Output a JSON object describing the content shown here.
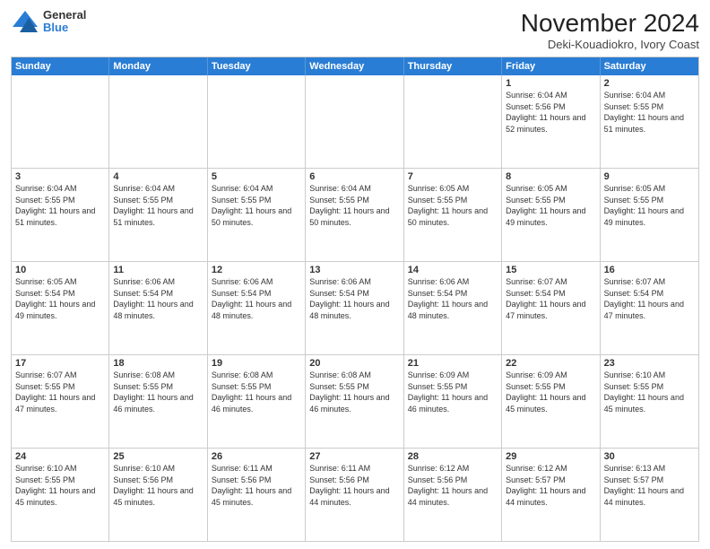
{
  "header": {
    "logo": {
      "line1": "General",
      "line2": "Blue"
    },
    "title": "November 2024",
    "location": "Deki-Kouadiokro, Ivory Coast"
  },
  "calendar": {
    "days_of_week": [
      "Sunday",
      "Monday",
      "Tuesday",
      "Wednesday",
      "Thursday",
      "Friday",
      "Saturday"
    ],
    "weeks": [
      [
        {
          "day": "",
          "info": "",
          "empty": true
        },
        {
          "day": "",
          "info": "",
          "empty": true
        },
        {
          "day": "",
          "info": "",
          "empty": true
        },
        {
          "day": "",
          "info": "",
          "empty": true
        },
        {
          "day": "",
          "info": "",
          "empty": true
        },
        {
          "day": "1",
          "info": "Sunrise: 6:04 AM\nSunset: 5:56 PM\nDaylight: 11 hours\nand 52 minutes."
        },
        {
          "day": "2",
          "info": "Sunrise: 6:04 AM\nSunset: 5:55 PM\nDaylight: 11 hours\nand 51 minutes."
        }
      ],
      [
        {
          "day": "3",
          "info": "Sunrise: 6:04 AM\nSunset: 5:55 PM\nDaylight: 11 hours\nand 51 minutes."
        },
        {
          "day": "4",
          "info": "Sunrise: 6:04 AM\nSunset: 5:55 PM\nDaylight: 11 hours\nand 51 minutes."
        },
        {
          "day": "5",
          "info": "Sunrise: 6:04 AM\nSunset: 5:55 PM\nDaylight: 11 hours\nand 50 minutes."
        },
        {
          "day": "6",
          "info": "Sunrise: 6:04 AM\nSunset: 5:55 PM\nDaylight: 11 hours\nand 50 minutes."
        },
        {
          "day": "7",
          "info": "Sunrise: 6:05 AM\nSunset: 5:55 PM\nDaylight: 11 hours\nand 50 minutes."
        },
        {
          "day": "8",
          "info": "Sunrise: 6:05 AM\nSunset: 5:55 PM\nDaylight: 11 hours\nand 49 minutes."
        },
        {
          "day": "9",
          "info": "Sunrise: 6:05 AM\nSunset: 5:55 PM\nDaylight: 11 hours\nand 49 minutes."
        }
      ],
      [
        {
          "day": "10",
          "info": "Sunrise: 6:05 AM\nSunset: 5:54 PM\nDaylight: 11 hours\nand 49 minutes."
        },
        {
          "day": "11",
          "info": "Sunrise: 6:06 AM\nSunset: 5:54 PM\nDaylight: 11 hours\nand 48 minutes."
        },
        {
          "day": "12",
          "info": "Sunrise: 6:06 AM\nSunset: 5:54 PM\nDaylight: 11 hours\nand 48 minutes."
        },
        {
          "day": "13",
          "info": "Sunrise: 6:06 AM\nSunset: 5:54 PM\nDaylight: 11 hours\nand 48 minutes."
        },
        {
          "day": "14",
          "info": "Sunrise: 6:06 AM\nSunset: 5:54 PM\nDaylight: 11 hours\nand 48 minutes."
        },
        {
          "day": "15",
          "info": "Sunrise: 6:07 AM\nSunset: 5:54 PM\nDaylight: 11 hours\nand 47 minutes."
        },
        {
          "day": "16",
          "info": "Sunrise: 6:07 AM\nSunset: 5:54 PM\nDaylight: 11 hours\nand 47 minutes."
        }
      ],
      [
        {
          "day": "17",
          "info": "Sunrise: 6:07 AM\nSunset: 5:55 PM\nDaylight: 11 hours\nand 47 minutes."
        },
        {
          "day": "18",
          "info": "Sunrise: 6:08 AM\nSunset: 5:55 PM\nDaylight: 11 hours\nand 46 minutes."
        },
        {
          "day": "19",
          "info": "Sunrise: 6:08 AM\nSunset: 5:55 PM\nDaylight: 11 hours\nand 46 minutes."
        },
        {
          "day": "20",
          "info": "Sunrise: 6:08 AM\nSunset: 5:55 PM\nDaylight: 11 hours\nand 46 minutes."
        },
        {
          "day": "21",
          "info": "Sunrise: 6:09 AM\nSunset: 5:55 PM\nDaylight: 11 hours\nand 46 minutes."
        },
        {
          "day": "22",
          "info": "Sunrise: 6:09 AM\nSunset: 5:55 PM\nDaylight: 11 hours\nand 45 minutes."
        },
        {
          "day": "23",
          "info": "Sunrise: 6:10 AM\nSunset: 5:55 PM\nDaylight: 11 hours\nand 45 minutes."
        }
      ],
      [
        {
          "day": "24",
          "info": "Sunrise: 6:10 AM\nSunset: 5:55 PM\nDaylight: 11 hours\nand 45 minutes."
        },
        {
          "day": "25",
          "info": "Sunrise: 6:10 AM\nSunset: 5:56 PM\nDaylight: 11 hours\nand 45 minutes."
        },
        {
          "day": "26",
          "info": "Sunrise: 6:11 AM\nSunset: 5:56 PM\nDaylight: 11 hours\nand 45 minutes."
        },
        {
          "day": "27",
          "info": "Sunrise: 6:11 AM\nSunset: 5:56 PM\nDaylight: 11 hours\nand 44 minutes."
        },
        {
          "day": "28",
          "info": "Sunrise: 6:12 AM\nSunset: 5:56 PM\nDaylight: 11 hours\nand 44 minutes."
        },
        {
          "day": "29",
          "info": "Sunrise: 6:12 AM\nSunset: 5:57 PM\nDaylight: 11 hours\nand 44 minutes."
        },
        {
          "day": "30",
          "info": "Sunrise: 6:13 AM\nSunset: 5:57 PM\nDaylight: 11 hours\nand 44 minutes."
        }
      ]
    ]
  }
}
